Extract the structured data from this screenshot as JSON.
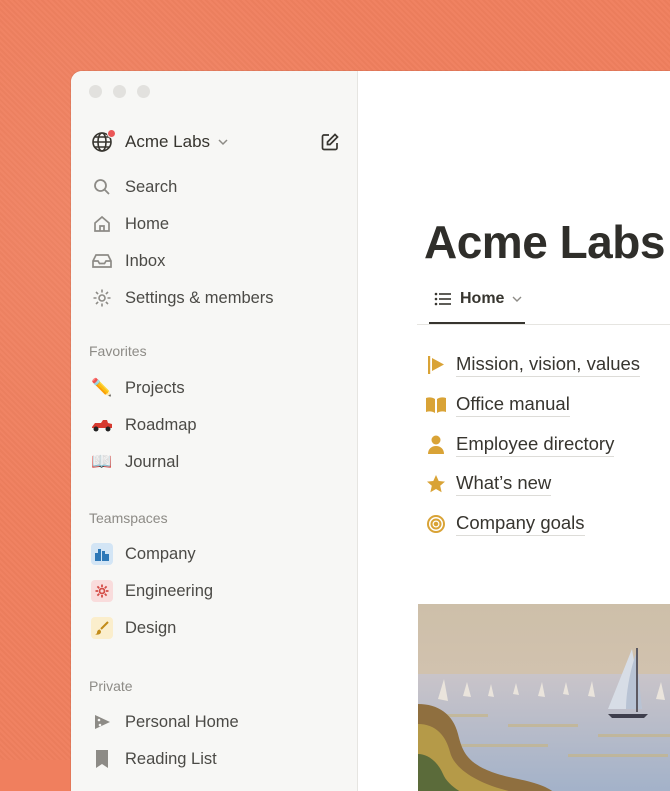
{
  "workspace": {
    "name": "Acme Labs"
  },
  "sidebar": {
    "nav": [
      {
        "label": "Search",
        "icon": "search-icon"
      },
      {
        "label": "Home",
        "icon": "home-icon"
      },
      {
        "label": "Inbox",
        "icon": "inbox-icon"
      },
      {
        "label": "Settings & members",
        "icon": "gear-icon"
      }
    ],
    "favorites_heading": "Favorites",
    "favorites": [
      {
        "label": "Projects",
        "icon": "pencil-icon"
      },
      {
        "label": "Roadmap",
        "icon": "race-car-icon"
      },
      {
        "label": "Journal",
        "icon": "open-book-icon"
      }
    ],
    "teamspaces_heading": "Teamspaces",
    "teamspaces": [
      {
        "label": "Company",
        "icon": "city-icon"
      },
      {
        "label": "Engineering",
        "icon": "cog-icon"
      },
      {
        "label": "Design",
        "icon": "paintbrush-icon"
      }
    ],
    "private_heading": "Private",
    "private": [
      {
        "label": "Personal Home",
        "icon": "pizza-icon"
      },
      {
        "label": "Reading List",
        "icon": "bookmark-icon"
      }
    ]
  },
  "page": {
    "title": "Acme Labs",
    "tab": "Home",
    "links": [
      {
        "label": "Mission, vision, values",
        "icon": "flag-icon"
      },
      {
        "label": "Office manual",
        "icon": "book-icon"
      },
      {
        "label": "Employee directory",
        "icon": "person-icon"
      },
      {
        "label": "What’s new",
        "icon": "star-icon"
      },
      {
        "label": "Company goals",
        "icon": "target-icon"
      }
    ]
  },
  "colors": {
    "background": "#f07f5e",
    "icon_gold": "#d9a336",
    "sidebar": "#f7f7f5"
  }
}
